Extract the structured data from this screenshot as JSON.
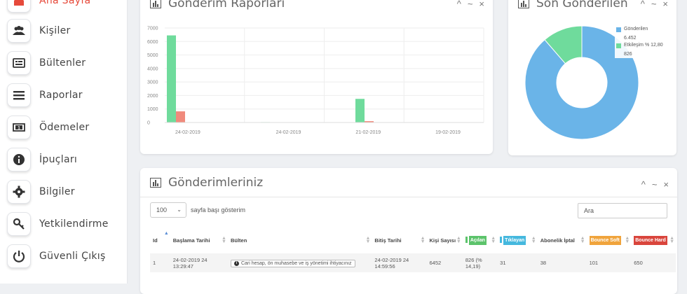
{
  "sidebar": {
    "items": [
      {
        "label": "Ana Sayfa",
        "icon": "home-icon",
        "active": true
      },
      {
        "label": "Kişiler",
        "icon": "users-icon"
      },
      {
        "label": "Bültenler",
        "icon": "newsletter-icon"
      },
      {
        "label": "Raporlar",
        "icon": "menu-icon"
      },
      {
        "label": "Ödemeler",
        "icon": "money-icon"
      },
      {
        "label": "İpuçları",
        "icon": "info-icon"
      },
      {
        "label": "Bilgiler",
        "icon": "gear-icon"
      },
      {
        "label": "Yetkilendirme",
        "icon": "key-icon"
      },
      {
        "label": "Güvenli Çıkış",
        "icon": "power-icon"
      }
    ]
  },
  "reports_panel": {
    "title": "Gönderim Raporları",
    "tools": [
      "^",
      "~",
      "×"
    ]
  },
  "last_panel": {
    "title": "Son Gönderilen",
    "tools": [
      "^",
      "~",
      "×"
    ]
  },
  "sends_panel": {
    "title": "Gönderimleriniz",
    "tools": [
      "^",
      "~",
      "×"
    ],
    "page_size": "100",
    "page_size_text": "sayfa başı gösterim",
    "search_placeholder": "Ara"
  },
  "chart_data": [
    {
      "type": "bar",
      "categories": [
        "24-02-2019",
        "24-02-2019",
        "21-02-2019",
        "19-02-2019"
      ],
      "ylim": [
        0,
        7000
      ],
      "yticks": [
        "0",
        "1000",
        "2000",
        "3000",
        "4000",
        "5000",
        "6000",
        "7000"
      ],
      "series": [
        {
          "values": [
            6452,
            30,
            1750,
            10
          ],
          "color": "#6fdb9c"
        },
        {
          "values": [
            826,
            8,
            100,
            2
          ],
          "color": "#f08a7c"
        }
      ]
    },
    {
      "type": "pie",
      "legend": [
        {
          "label": "Gönderilen",
          "value": "6.452",
          "color": "#6ab4e8"
        },
        {
          "label": "Etkileşim % 12,80",
          "value": "826",
          "color": "#6fdb9c"
        }
      ],
      "values": [
        6452,
        826
      ]
    }
  ],
  "table": {
    "headers": [
      "Id",
      "Başlama Tarihi",
      "Bülten",
      "Bitiş Tarihi",
      "Kişi Sayısı",
      "Açılan",
      "Tıklayan",
      "Abonelik İptal",
      "Bounce Soft",
      "Bounce Hard"
    ],
    "header_colors": {
      "Açılan": "#5cc36b",
      "Tıklayan": "#45b8de",
      "Bounce Soft": "#f0a43c",
      "Bounce Hard": "#d9453c"
    },
    "rows": [
      {
        "id": "1",
        "start": "24-02-2019 24 13:29:47",
        "bulletin": "Cari hesap, ön muhasebe ve iş yönetimi ihtiyacınız",
        "end": "24-02-2019 24 14:59:56",
        "count": "6452",
        "opened": "826 (% 14,19)",
        "clicked": "31",
        "unsub": "38",
        "soft": "101",
        "hard": "650"
      }
    ]
  }
}
